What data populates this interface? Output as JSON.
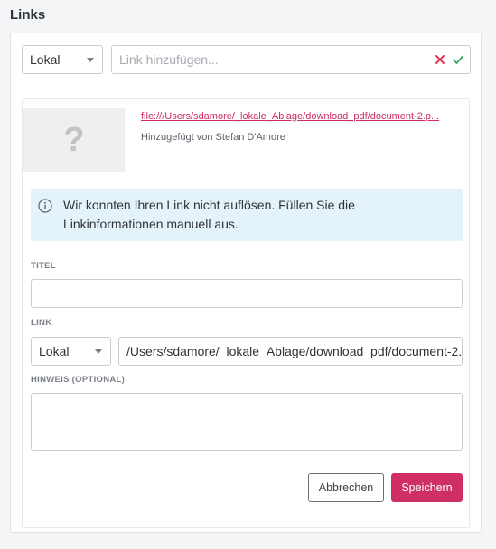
{
  "section": {
    "title": "Links"
  },
  "add_row": {
    "type_select": "Lokal",
    "link_placeholder": "Link hinzufügen..."
  },
  "preview": {
    "thumb_symbol": "?",
    "file_link": "file:///Users/sdamore/_lokale_Ablage/download_pdf/document-2.p...",
    "added_by": "Hinzugefügt von Stefan D'Amore"
  },
  "alert": {
    "message": "Wir konnten Ihren Link nicht auflösen. Füllen Sie die Linkinformationen manuell aus."
  },
  "form": {
    "title_label": "TITEL",
    "title_value": "",
    "link_label": "LINK",
    "link_type": "Lokal",
    "link_value": "/Users/sdamore/_lokale_Ablage/download_pdf/document-2.",
    "note_label": "HINWEIS (OPTIONAL)",
    "note_value": ""
  },
  "actions": {
    "cancel": "Abbrechen",
    "save": "Speichern"
  },
  "colors": {
    "accent": "#d02f64",
    "error": "#e0365a",
    "success": "#3aa56b",
    "info_bg": "#e4f3fa"
  }
}
